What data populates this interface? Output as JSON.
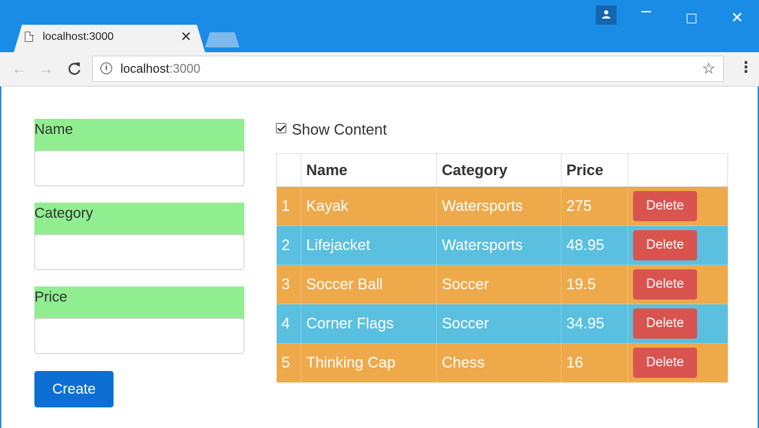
{
  "browser": {
    "tab_title": "localhost:3000",
    "url_host": "localhost",
    "url_port": ":3000",
    "icons": {
      "tab": "page-icon",
      "close": "close-icon",
      "back": "back-arrow-icon",
      "forward": "forward-arrow-icon",
      "reload": "reload-icon",
      "info": "info-icon",
      "star": "star-icon",
      "menu": "kebab-menu-icon",
      "profile": "profile-icon"
    },
    "symbols": {
      "close": "✕",
      "back": "←",
      "forward": "→",
      "reload": "C",
      "info": "i",
      "star": "☆",
      "menu": "⋮",
      "win_close": "✕"
    }
  },
  "form": {
    "fields": [
      {
        "label": "Name",
        "value": ""
      },
      {
        "label": "Category",
        "value": ""
      },
      {
        "label": "Price",
        "value": ""
      }
    ],
    "create_label": "Create"
  },
  "show_content": {
    "label": "Show Content",
    "checked": true
  },
  "table": {
    "headers": [
      "",
      "Name",
      "Category",
      "Price",
      ""
    ],
    "rows": [
      {
        "id": "1",
        "name": "Kayak",
        "category": "Watersports",
        "price": "275",
        "action": "Delete"
      },
      {
        "id": "2",
        "name": "Lifejacket",
        "category": "Watersports",
        "price": "48.95",
        "action": "Delete"
      },
      {
        "id": "3",
        "name": "Soccer Ball",
        "category": "Soccer",
        "price": "19.5",
        "action": "Delete"
      },
      {
        "id": "4",
        "name": "Corner Flags",
        "category": "Soccer",
        "price": "34.95",
        "action": "Delete"
      },
      {
        "id": "5",
        "name": "Thinking Cap",
        "category": "Chess",
        "price": "16",
        "action": "Delete"
      }
    ]
  },
  "colors": {
    "titlebar": "#1a8ce6",
    "label_bg": "#90ee90",
    "row_orange": "#eea94b",
    "row_blue": "#5bbfdf",
    "delete": "#d9534f",
    "create": "#0d6fd4"
  }
}
